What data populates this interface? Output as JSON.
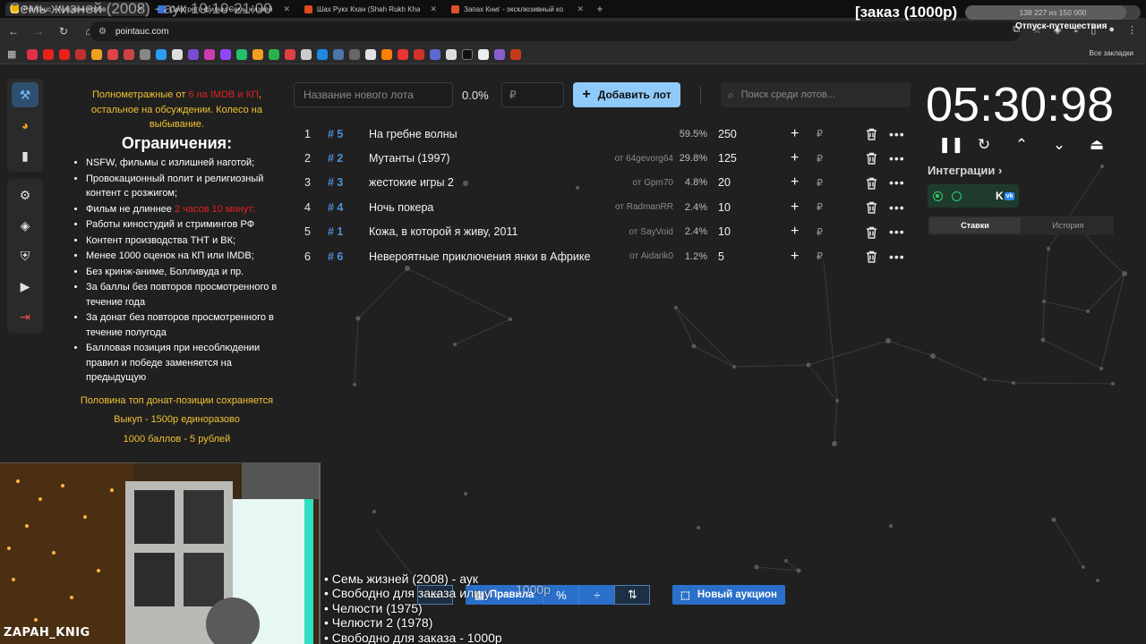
{
  "browser": {
    "tabs": [
      {
        "label": "Pointauc - Аукцион лотов",
        "color": "#f0b400",
        "active": true
      },
      {
        "label": "Смотреть фильм Семь жизней",
        "color": "#3d6fd6",
        "active": false
      },
      {
        "label": "Шах Рукх Кхан (Shah Rukh Kha",
        "color": "#e04a1f",
        "active": false
      },
      {
        "label": "Запах Книг - эксклюзивный ко",
        "color": "#e0502a",
        "active": false
      }
    ],
    "url": "pointauc.com",
    "bookmarks_all": "Все закладки"
  },
  "sidebar": {
    "icons": [
      "auction-icon",
      "pie-chart-icon",
      "bar-chart-icon",
      "settings-icon",
      "layers-icon",
      "shield-icon",
      "video-icon",
      "logout-icon"
    ]
  },
  "rules": {
    "intro_1": "Полнометражные от ",
    "intro_red": "6 на IMDB и КП",
    "intro_2": ", остальное на обсуждении. Колесо на выбывание.",
    "heading": "Ограничения:",
    "items": [
      "NSFW, фильмы с излишней наготой;",
      "Провокационный полит и религиозный контент с розжигом;",
      "Фильм не длиннее ",
      "Работы киностудий и стримингов РФ",
      "Контент производства ТНТ и ВК;",
      "Менее 1000 оценок на КП или IMDB;",
      "Без кринж-аниме, Болливуда и пр.",
      "За баллы без повторов просмотренного в течение года",
      "За донат без повторов просмотренного в течение полугода",
      "Балловая позиция при несоблюдении правил и победе заменяется на предыдущую"
    ],
    "item3_red": "2 часов 10 минут;",
    "foot_1": "Половина топ донат-позиции сохраняется",
    "foot_2": "Выкуп - 1500р единоразово",
    "foot_3": "1000 баллов - 5 рублей"
  },
  "toolbar": {
    "lot_placeholder": "Название нового лота",
    "percent": "0.0%",
    "rub_placeholder": "₽",
    "add_label": "Добавить лот",
    "search_placeholder": "Поиск среди лотов..."
  },
  "lots": [
    {
      "n": "1",
      "id": "# 5",
      "name": "На гребне волны",
      "from": "",
      "pct": "59.5%",
      "amount": "250"
    },
    {
      "n": "2",
      "id": "# 2",
      "name": "Мутанты (1997)",
      "from": "от 64gevorg64",
      "pct": "29.8%",
      "amount": "125"
    },
    {
      "n": "3",
      "id": "# 3",
      "name": "жестокие игры 2",
      "from": "от Gpm70",
      "pct": "4.8%",
      "amount": "20"
    },
    {
      "n": "4",
      "id": "# 4",
      "name": "Ночь покера",
      "from": "от RadmanRR",
      "pct": "2.4%",
      "amount": "10"
    },
    {
      "n": "5",
      "id": "# 1",
      "name": "Кожа, в которой я живу, 2011",
      "from": "от SayVoid",
      "pct": "2.4%",
      "amount": "10"
    },
    {
      "n": "6",
      "id": "# 6",
      "name": "Невероятные приключения янки в Африке",
      "from": "от Aidarik0",
      "pct": "1.2%",
      "amount": "5"
    }
  ],
  "timer": {
    "value": "05:30:98",
    "integrations_label": "Интеграции",
    "tab_bets": "Ставки",
    "tab_history": "История"
  },
  "bottom": {
    "rules_label": "Правила",
    "new_auction_label": "Новый аукцион"
  },
  "overlay": {
    "title": "Семь жизней (2008) - аук 19:10-21:00",
    "order": "[заказ (1000р)",
    "progress_text": "138 227  из 150 000",
    "progress_value": 0.92,
    "vacation": "Отпуск-путешествия",
    "cam_name": "ZAPAH_KNIG",
    "playlist": [
      "• Семь жизней (2008) - аук",
      "• Свободно для заказа или у",
      "• Челюсти (1975)",
      "• Челюсти 2 (1978)",
      "• Свободно для заказа - 1000р"
    ],
    "playlist_overlap": "1000р"
  },
  "colors": {
    "accent": "#90caf9",
    "primary_blue": "#2a6fc9",
    "id_blue": "#4f8fd8",
    "warn_yellow": "#f1c232",
    "warn_red": "#e02020"
  }
}
